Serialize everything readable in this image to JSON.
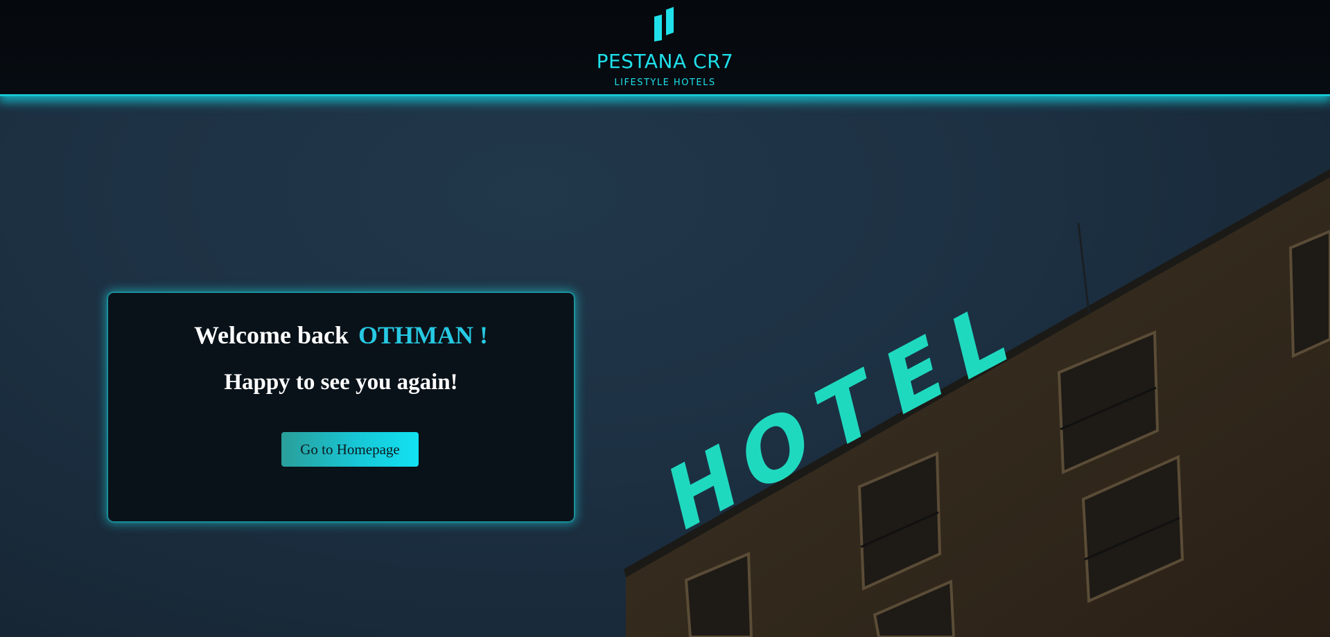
{
  "header": {
    "brand_name": "PESTANA CR7",
    "brand_sub": "LIFESTYLE HOTELS",
    "logo_icon": "pestana-logo-icon"
  },
  "background": {
    "sign_letters": [
      "H",
      "O",
      "T",
      "E",
      "L"
    ],
    "accent_color": "#1fe0ea",
    "sign_color": "#1fd9bf"
  },
  "card": {
    "welcome_prefix": "Welcome back",
    "username": "OTHMAN !",
    "tagline": "Happy to see you again!",
    "button_label": "Go to Homepage"
  }
}
